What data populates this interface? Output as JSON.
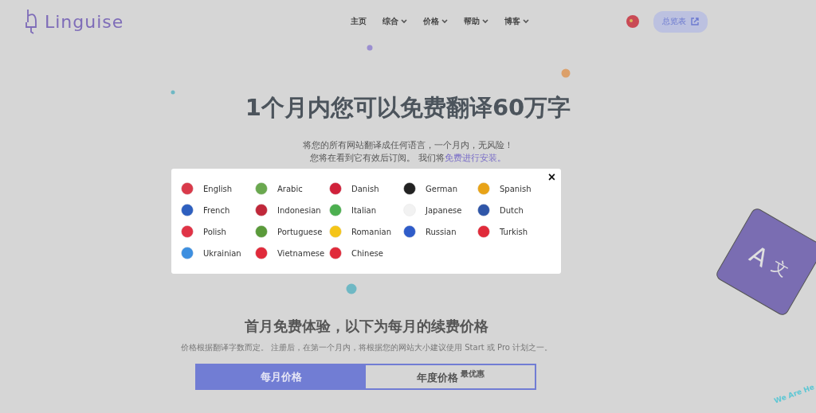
{
  "header": {
    "logo": "Linguise",
    "nav": [
      {
        "label": "主页",
        "dropdown": false
      },
      {
        "label": "综合",
        "dropdown": true
      },
      {
        "label": "价格",
        "dropdown": true
      },
      {
        "label": "帮助",
        "dropdown": true
      },
      {
        "label": "博客",
        "dropdown": true
      }
    ],
    "dashboard_button": "总览表"
  },
  "hero": {
    "title": "1个月内您可以免费翻译60万字",
    "subtitle_line_1": "将您的所有网站翻译成任何语言，一个月内，无风险！",
    "subtitle_line_2": "您将在看到它有效后订阅。 我们将",
    "subtitle_link": "免费进行安装。"
  },
  "pricing": {
    "heading": "首月免费体验，以下为每月的续费价格",
    "note": "价格根据翻译字数而定。 注册后，在第一个月内，将根据您的网站大小建议使用 Start 或 Pro 计划之一。",
    "tabs": [
      {
        "label": "每月价格",
        "selected": true
      },
      {
        "label": "年度价格",
        "selected": false,
        "badge": "最优惠"
      }
    ]
  },
  "key_drawing": {
    "glyph_1": "A",
    "glyph_2": "文"
  },
  "help_badge": "We Are He",
  "language_modal": {
    "close": "×",
    "languages": [
      {
        "name": "English",
        "color": "#d93a4a"
      },
      {
        "name": "Arabic",
        "color": "#6aa84f"
      },
      {
        "name": "Danish",
        "color": "#d0213a"
      },
      {
        "name": "German",
        "color": "#222222"
      },
      {
        "name": "Spanish",
        "color": "#e8a317"
      },
      {
        "name": "French",
        "color": "#2e5fbf"
      },
      {
        "name": "Indonesian",
        "color": "#c0283a"
      },
      {
        "name": "Italian",
        "color": "#4caf50"
      },
      {
        "name": "Japanese",
        "color": "#f2f2f2"
      },
      {
        "name": "Dutch",
        "color": "#2f56a8"
      },
      {
        "name": "Polish",
        "color": "#e03346"
      },
      {
        "name": "Portuguese",
        "color": "#5a9a3a"
      },
      {
        "name": "Romanian",
        "color": "#f5c518"
      },
      {
        "name": "Russian",
        "color": "#2f5cc9"
      },
      {
        "name": "Turkish",
        "color": "#e02a3a"
      },
      {
        "name": "Ukrainian",
        "color": "#3d8fe0"
      },
      {
        "name": "Vietnamese",
        "color": "#e02a3a"
      },
      {
        "name": "Chinese",
        "color": "#e02a3a"
      }
    ]
  }
}
